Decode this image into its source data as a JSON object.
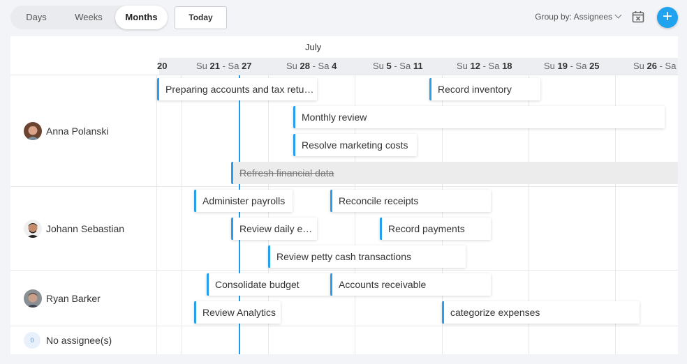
{
  "toolbar": {
    "view_tabs": [
      {
        "label": "Days",
        "active": false
      },
      {
        "label": "Weeks",
        "active": false
      },
      {
        "label": "Months",
        "active": true
      }
    ],
    "today_label": "Today",
    "group_by_label": "Group by: Assignees",
    "calendar_icon": "calendar-x-icon",
    "add_icon": "plus-icon"
  },
  "timeline": {
    "month_label": "July",
    "weeks": [
      {
        "prefix": "",
        "bold": "20",
        "mid": "",
        "bold2": ""
      },
      {
        "prefix": "Su ",
        "bold": "21",
        "mid": " - Sa ",
        "bold2": "27"
      },
      {
        "prefix": "Su ",
        "bold": "28",
        "mid": " - Sa ",
        "bold2": "4"
      },
      {
        "prefix": "Su ",
        "bold": "5",
        "mid": " - Sa ",
        "bold2": "11"
      },
      {
        "prefix": "Su ",
        "bold": "12",
        "mid": " - Sa ",
        "bold2": "18"
      },
      {
        "prefix": "Su ",
        "bold": "19",
        "mid": " - Sa ",
        "bold2": "25"
      },
      {
        "prefix": "Su ",
        "bold": "26",
        "mid": " - Sa",
        "bold2": ""
      }
    ]
  },
  "assignees": [
    {
      "name": "Anna Polanski",
      "avatar_color": "#b5715a"
    },
    {
      "name": "Johann Sebastian",
      "avatar_color": "#3a3a3a"
    },
    {
      "name": "Ryan Barker",
      "avatar_color": "#6e7378"
    },
    {
      "name": "No assignee(s)",
      "count": "0"
    }
  ],
  "tasks": [
    {
      "label": "Preparing accounts and tax retur…",
      "done": false
    },
    {
      "label": "Record inventory",
      "done": false
    },
    {
      "label": "Monthly review",
      "done": false
    },
    {
      "label": "Resolve marketing costs",
      "done": false
    },
    {
      "label": "Refresh financial data",
      "done": true
    },
    {
      "label": "Administer payrolls",
      "done": false
    },
    {
      "label": "Reconcile receipts",
      "done": false
    },
    {
      "label": "Review daily ex…",
      "done": false
    },
    {
      "label": "Record payments",
      "done": false
    },
    {
      "label": "Review petty cash transactions",
      "done": false
    },
    {
      "label": "Consolidate budget",
      "done": false
    },
    {
      "label": "Accounts receivable",
      "done": false
    },
    {
      "label": "Review Analytics",
      "done": false
    },
    {
      "label": "categorize expenses",
      "done": false
    }
  ],
  "colors": {
    "accent": "#1fa3ef",
    "task_bar": "#24a0ec",
    "today_line": "#1e9be8"
  }
}
